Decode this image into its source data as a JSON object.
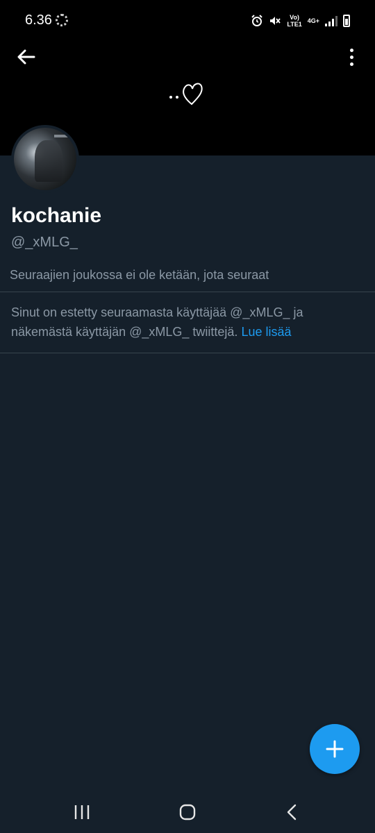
{
  "status_bar": {
    "time": "6.36",
    "network_line1": "Vo)",
    "network_line2": "LTE1",
    "network_type": "4G+",
    "icons": [
      "loading-icon",
      "alarm-icon",
      "mute-icon",
      "signal-icon",
      "battery-icon"
    ]
  },
  "header": {
    "back_icon": "arrow-left-icon",
    "more_icon": "more-vertical-icon",
    "banner_art": "dots-heart-doodle"
  },
  "profile": {
    "display_name": "kochanie",
    "handle": "@_xMLG_",
    "followers_you_follow": "Seuraajien joukossa ei ole ketään, jota seuraat",
    "blocked_message": "Sinut on estetty seuraamasta käyttäjää @_xMLG_ ja näkemästä käyttäjän @_xMLG_ twiittejä.",
    "learn_more": "Lue lisää"
  },
  "fab": {
    "icon": "plus-icon"
  },
  "nav_bar": {
    "icons": [
      "recent-apps-icon",
      "home-icon",
      "back-icon"
    ]
  },
  "colors": {
    "background": "#15202b",
    "banner": "#000000",
    "accent": "#1d9bf0",
    "secondary_text": "#8b98a5",
    "divider": "#38444d"
  }
}
